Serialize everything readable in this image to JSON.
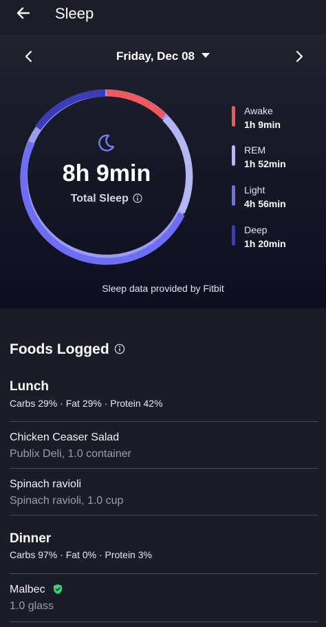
{
  "header": {
    "title": "Sleep"
  },
  "date_nav": {
    "label": "Friday, Dec 08"
  },
  "sleep": {
    "total_time": "8h 9min",
    "total_label": "Total Sleep",
    "stages": [
      {
        "name": "Awake",
        "value": "1h 9min",
        "color": "#f0595f"
      },
      {
        "name": "REM",
        "value": "1h 52min",
        "color": "#b5b7f4"
      },
      {
        "name": "Light",
        "value": "4h 56min",
        "color": "#6e6ef2"
      },
      {
        "name": "Deep",
        "value": "1h 20min",
        "color": "#3a3db8"
      }
    ],
    "provider": "Sleep data provided by Fitbit"
  },
  "foods": {
    "heading": "Foods Logged",
    "meals": [
      {
        "name": "Lunch",
        "macros": "Carbs 29% · Fat 29% · Protein 42%",
        "items": [
          {
            "name": "Chicken Ceaser Salad",
            "detail": "Publix Deli, 1.0 container"
          },
          {
            "name": "Spinach ravioli",
            "detail": "Spinach ravioli, 1.0 cup"
          }
        ]
      },
      {
        "name": "Dinner",
        "macros": "Carbs 97% · Fat 0% · Protein 3%",
        "items": [
          {
            "name": "Malbec",
            "detail": "1.0 glass",
            "verified": true
          }
        ]
      }
    ]
  },
  "colors": {
    "accent_verified": "#3ccf7a",
    "background": "#1b1c27"
  }
}
